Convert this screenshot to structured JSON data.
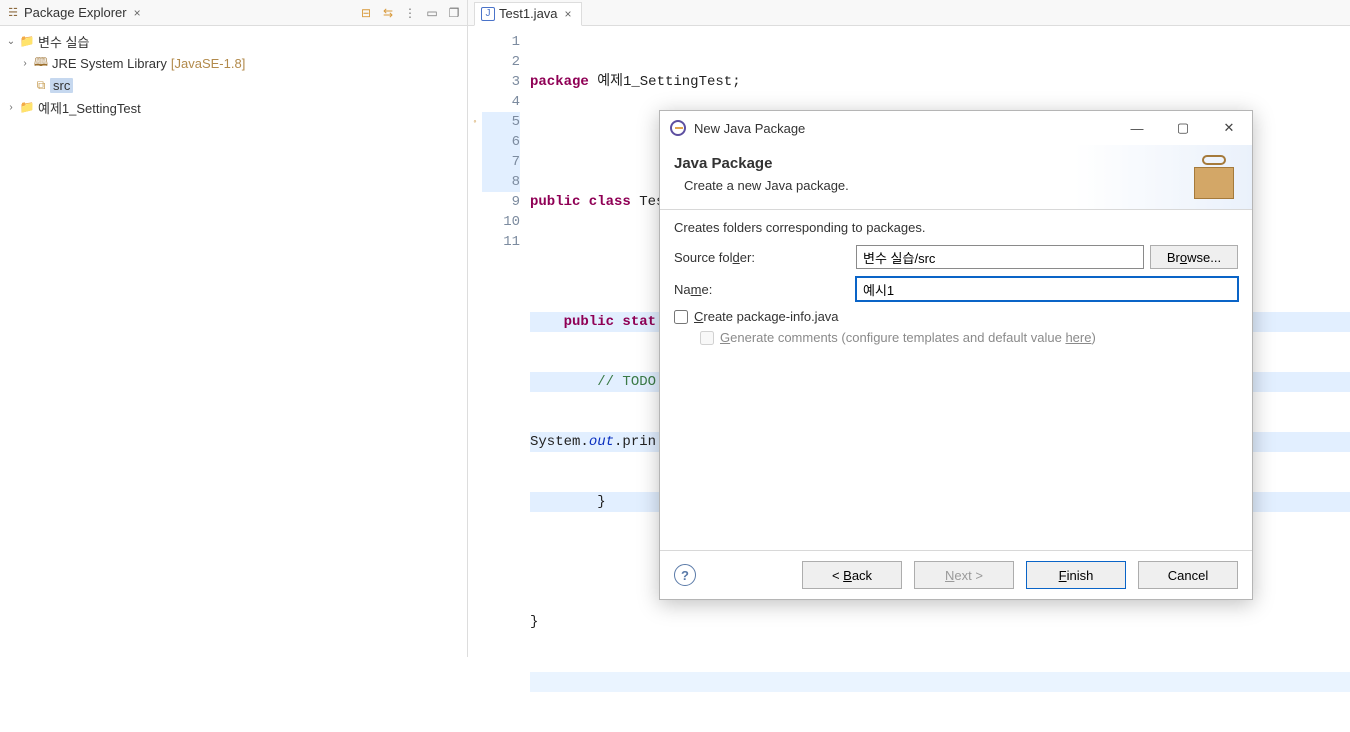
{
  "explorer": {
    "title": "Package Explorer",
    "nodes": {
      "proj1": {
        "label": "변수 실습"
      },
      "jre": {
        "label": "JRE System Library",
        "decor": "[JavaSE-1.8]"
      },
      "src": {
        "label": "src"
      },
      "proj2": {
        "label": "예제1_SettingTest"
      }
    }
  },
  "editor": {
    "tab": "Test1.java",
    "lines": {
      "l1_kw": "package",
      "l1_rest": " 예제1_SettingTest;",
      "l3_kw": "public class",
      "l3_rest": " Test1 {",
      "l5_kw": "public stat",
      "l5_rest": "",
      "l6_cmt": "// TODO",
      "l7_a": "System.",
      "l7_b": "out",
      "l7_c": ".prin",
      "l8": "        }",
      "l10": "}"
    },
    "linenums": [
      "1",
      "2",
      "3",
      "4",
      "5",
      "6",
      "7",
      "8",
      "9",
      "10",
      "11"
    ]
  },
  "dialog": {
    "title": "New Java Package",
    "heading": "Java Package",
    "subheading": "Create a new Java package.",
    "note": "Creates folders corresponding to packages.",
    "labels": {
      "source": "Source folder:",
      "name": "Name:",
      "browse": "Browse...",
      "chk1": "Create package-info.java",
      "chk2a": "Generate comments (configure templates and default value ",
      "chk2b": "here",
      "chk2c": ")"
    },
    "values": {
      "source": "변수 실습/src",
      "name": "예시1"
    },
    "buttons": {
      "back": "Back",
      "next": "Next >",
      "finish": "Finish",
      "cancel": "Cancel"
    }
  }
}
